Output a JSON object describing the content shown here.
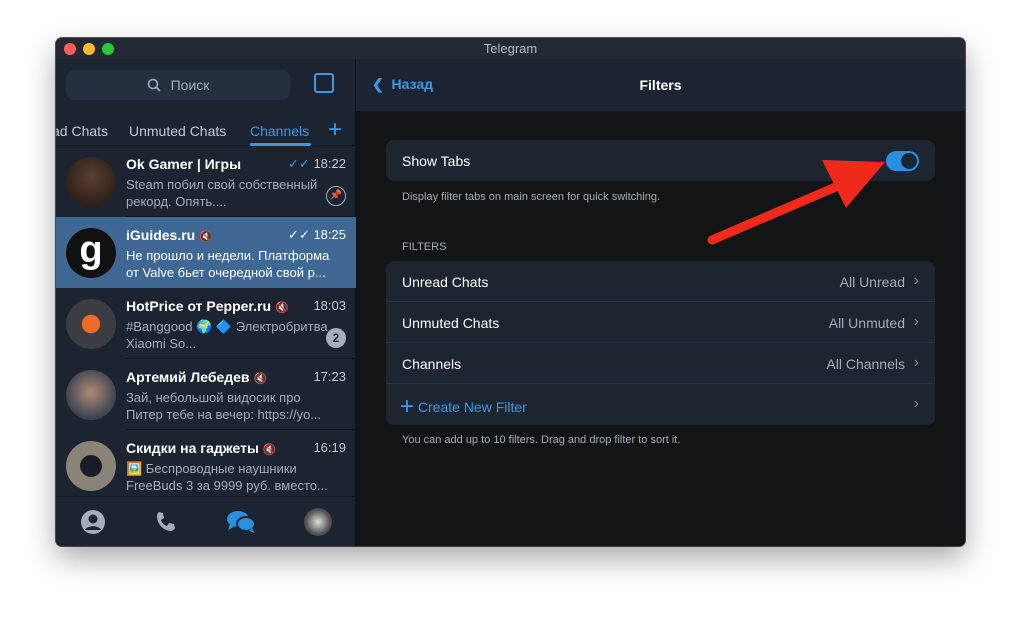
{
  "window": {
    "title": "Telegram"
  },
  "sidebar": {
    "search_placeholder": "Поиск",
    "tabs": [
      "ad Chats",
      "Unmuted Chats",
      "Channels"
    ],
    "chats": [
      {
        "name": "Ok Gamer | Игры",
        "time": "18:22",
        "msg": "Steam побил свой собственный рекорд. Опять....",
        "status": "pinned"
      },
      {
        "name": "iGuides.ru",
        "time": "18:25",
        "msg": "Не прошло и недели. Платформа от Valve бьет очередной свой р...",
        "status": "muted"
      },
      {
        "name": "HotPrice от Pepper.ru",
        "time": "18:03",
        "msg": "#Banggood 🌍 🔷 Электробритва Xiaomi So...",
        "badge": "2"
      },
      {
        "name": "Артемий Лебедев",
        "time": "17:23",
        "msg": "Зай, небольшой видосик про Питер тебе на вечер: https://yo..."
      },
      {
        "name": "Скидки на гаджеты",
        "time": "16:19",
        "msg": "🖼️ Беспроводные наушники FreeBuds 3 за 9999 руб. вместо..."
      }
    ]
  },
  "main": {
    "back": "Назад",
    "title": "Filters",
    "show_tabs": "Show Tabs",
    "show_tabs_on": true,
    "show_tabs_note": "Display filter tabs on main screen for quick switching.",
    "filters_header": "FILTERS",
    "filters": [
      {
        "name": "Unread Chats",
        "value": "All Unread"
      },
      {
        "name": "Unmuted Chats",
        "value": "All Unmuted"
      },
      {
        "name": "Channels",
        "value": "All Channels"
      }
    ],
    "create": "Create New Filter",
    "footer_note": "You can add up to 10 filters. Drag and drop filter to sort it."
  },
  "colors": {
    "accent": "#3a9ae8",
    "annotation_arrow": "#f0291b"
  }
}
